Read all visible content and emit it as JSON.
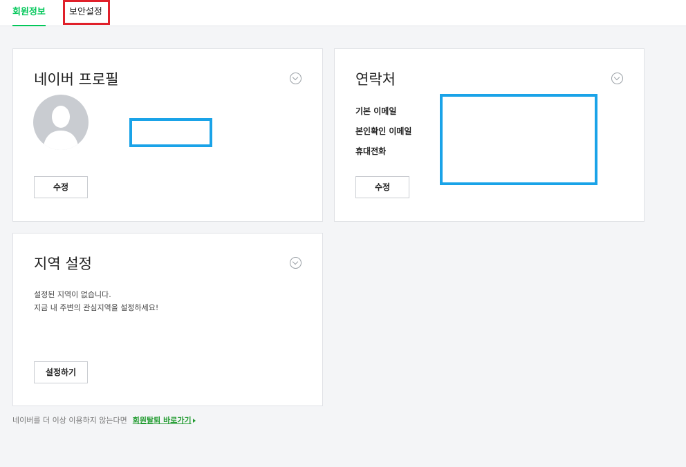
{
  "tabs": [
    {
      "label": "회원정보",
      "active": true
    },
    {
      "label": "보안설정",
      "active": false
    }
  ],
  "profile": {
    "title": "네이버 프로필",
    "edit_button": "수정"
  },
  "contact": {
    "title": "연락처",
    "labels": [
      "기본 이메일",
      "본인확인 이메일",
      "휴대전화"
    ],
    "edit_button": "수정"
  },
  "region": {
    "title": "지역 설정",
    "line1": "설정된 지역이 없습니다.",
    "line2": "지금 내 주변의 관심지역을 설정하세요!",
    "button": "설정하기"
  },
  "footer": {
    "text": "네이버를 더 이상 이용하지 않는다면",
    "link": "회원탈퇴 바로가기"
  },
  "colors": {
    "accent": "#03c75a",
    "highlight_red": "#e0202a",
    "highlight_blue": "#1aa3e8",
    "link": "#1f9a2e"
  },
  "icons": [
    "chevron-down-circle-icon",
    "avatar-silhouette-icon",
    "arrow-right-icon"
  ]
}
